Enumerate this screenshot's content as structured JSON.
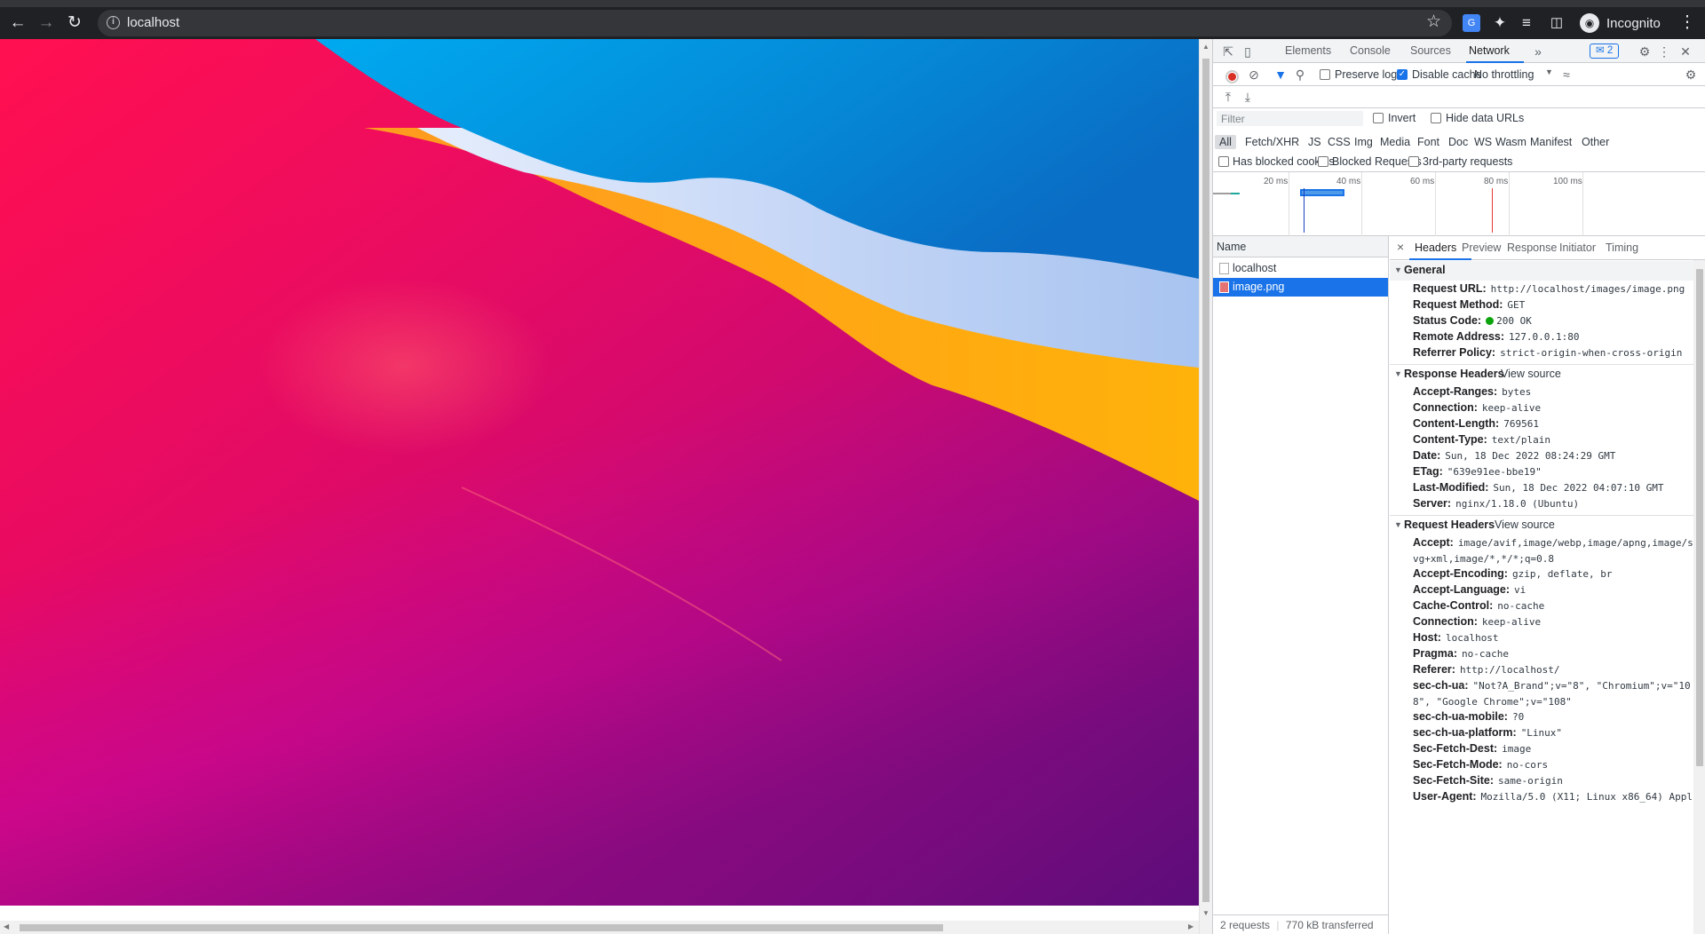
{
  "browser": {
    "url": "localhost",
    "profile_label": "Incognito"
  },
  "devtools": {
    "tabs": [
      "Elements",
      "Console",
      "Sources",
      "Network"
    ],
    "active_tab": "Network",
    "issues_count": "2",
    "toolbar": {
      "preserve_log": "Preserve log",
      "disable_cache": "Disable cache",
      "throttling": "No throttling"
    },
    "filter": {
      "placeholder": "Filter",
      "invert": "Invert",
      "hide_data_urls": "Hide data URLs",
      "types": [
        "All",
        "Fetch/XHR",
        "JS",
        "CSS",
        "Img",
        "Media",
        "Font",
        "Doc",
        "WS",
        "Wasm",
        "Manifest",
        "Other"
      ],
      "has_blocked_cookies": "Has blocked cookies",
      "blocked_requests": "Blocked Requests",
      "third_party": "3rd-party requests"
    },
    "overview": {
      "ticks": [
        "20 ms",
        "40 ms",
        "60 ms",
        "80 ms",
        "100 ms"
      ]
    },
    "requests": {
      "header": "Name",
      "items": [
        "localhost",
        "image.png"
      ],
      "selected": "image.png"
    },
    "status": {
      "requests": "2 requests",
      "transferred": "770 kB transferred"
    },
    "detail": {
      "close": "×",
      "tabs": [
        "Headers",
        "Preview",
        "Response",
        "Initiator",
        "Timing"
      ],
      "general": {
        "title": "General",
        "rows": [
          {
            "k": "Request URL:",
            "v": "http://localhost/images/image.png"
          },
          {
            "k": "Request Method:",
            "v": "GET"
          },
          {
            "k": "Status Code:",
            "v": "200 OK"
          },
          {
            "k": "Remote Address:",
            "v": "127.0.0.1:80"
          },
          {
            "k": "Referrer Policy:",
            "v": "strict-origin-when-cross-origin"
          }
        ]
      },
      "response_headers": {
        "title": "Response Headers",
        "view_source": "View source",
        "rows": [
          {
            "k": "Accept-Ranges:",
            "v": "bytes"
          },
          {
            "k": "Connection:",
            "v": "keep-alive"
          },
          {
            "k": "Content-Length:",
            "v": "769561"
          },
          {
            "k": "Content-Type:",
            "v": "text/plain"
          },
          {
            "k": "Date:",
            "v": "Sun, 18 Dec 2022 08:24:29 GMT"
          },
          {
            "k": "ETag:",
            "v": "\"639e91ee-bbe19\""
          },
          {
            "k": "Last-Modified:",
            "v": "Sun, 18 Dec 2022 04:07:10 GMT"
          },
          {
            "k": "Server:",
            "v": "nginx/1.18.0 (Ubuntu)"
          }
        ]
      },
      "request_headers": {
        "title": "Request Headers",
        "view_source": "View source",
        "rows": [
          {
            "k": "Accept:",
            "v": "image/avif,image/webp,image/apng,image/svg+xml,image/*,*/*;q=0.8"
          },
          {
            "k": "Accept-Encoding:",
            "v": "gzip, deflate, br"
          },
          {
            "k": "Accept-Language:",
            "v": "vi"
          },
          {
            "k": "Cache-Control:",
            "v": "no-cache"
          },
          {
            "k": "Connection:",
            "v": "keep-alive"
          },
          {
            "k": "Host:",
            "v": "localhost"
          },
          {
            "k": "Pragma:",
            "v": "no-cache"
          },
          {
            "k": "Referer:",
            "v": "http://localhost/"
          },
          {
            "k": "sec-ch-ua:",
            "v": "\"Not?A_Brand\";v=\"8\", \"Chromium\";v=\"108\", \"Google Chrome\";v=\"108\""
          },
          {
            "k": "sec-ch-ua-mobile:",
            "v": "?0"
          },
          {
            "k": "sec-ch-ua-platform:",
            "v": "\"Linux\""
          },
          {
            "k": "Sec-Fetch-Dest:",
            "v": "image"
          },
          {
            "k": "Sec-Fetch-Mode:",
            "v": "no-cors"
          },
          {
            "k": "Sec-Fetch-Site:",
            "v": "same-origin"
          },
          {
            "k": "User-Agent:",
            "v": "Mozilla/5.0 (X11; Linux x86_64) Appl"
          }
        ]
      }
    }
  },
  "colors": {
    "accent": "#1a73e8",
    "record": "#d93025",
    "status_ok": "#0ca40c"
  }
}
